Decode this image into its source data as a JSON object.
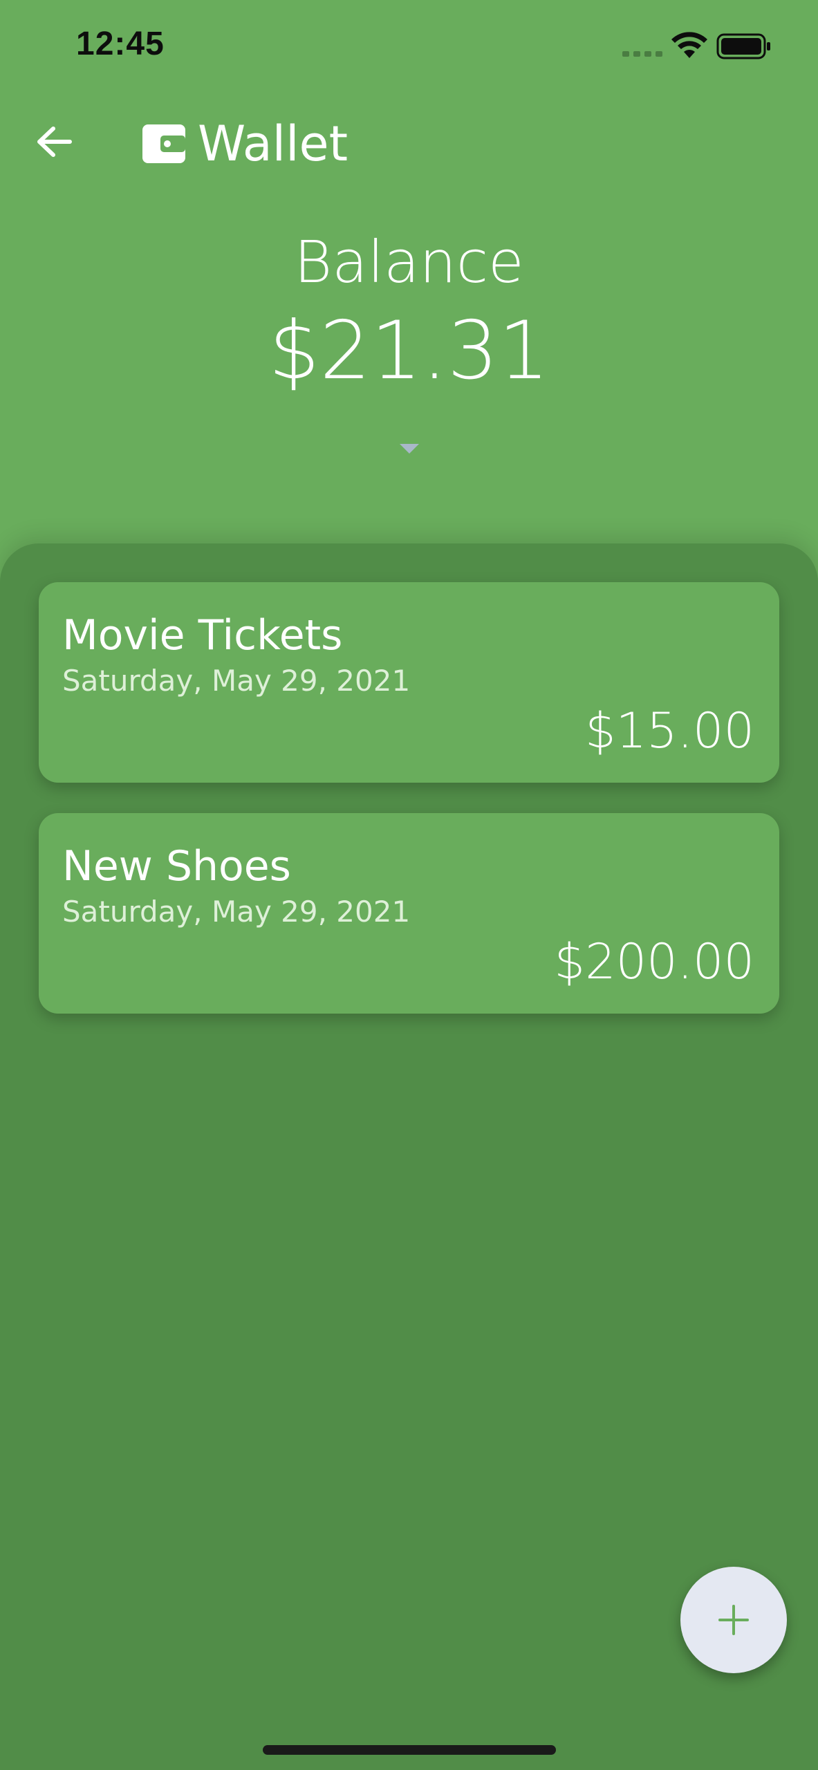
{
  "status_bar": {
    "time": "12:45",
    "icons": [
      "signal-dots-icon",
      "wifi-icon",
      "battery-icon"
    ]
  },
  "header": {
    "back_icon": "arrow-left-icon",
    "app_icon": "wallet-icon",
    "title": "Wallet"
  },
  "balance": {
    "label": "Balance",
    "value": "$21.31",
    "toggle_icon": "caret-down-icon"
  },
  "transactions": [
    {
      "title": "Movie Tickets",
      "date": "Saturday, May 29, 2021",
      "amount": "$15.00"
    },
    {
      "title": "New Shoes",
      "date": "Saturday, May 29, 2021",
      "amount": "$200.00"
    }
  ],
  "fab": {
    "icon": "plus-icon"
  },
  "colors": {
    "background": "#69ad5c",
    "sheet": "#518d48",
    "card": "#69ad5c",
    "fab": "#e4e8f2",
    "fab_icon": "#69ad5c",
    "caret": "#a9b8c9"
  }
}
